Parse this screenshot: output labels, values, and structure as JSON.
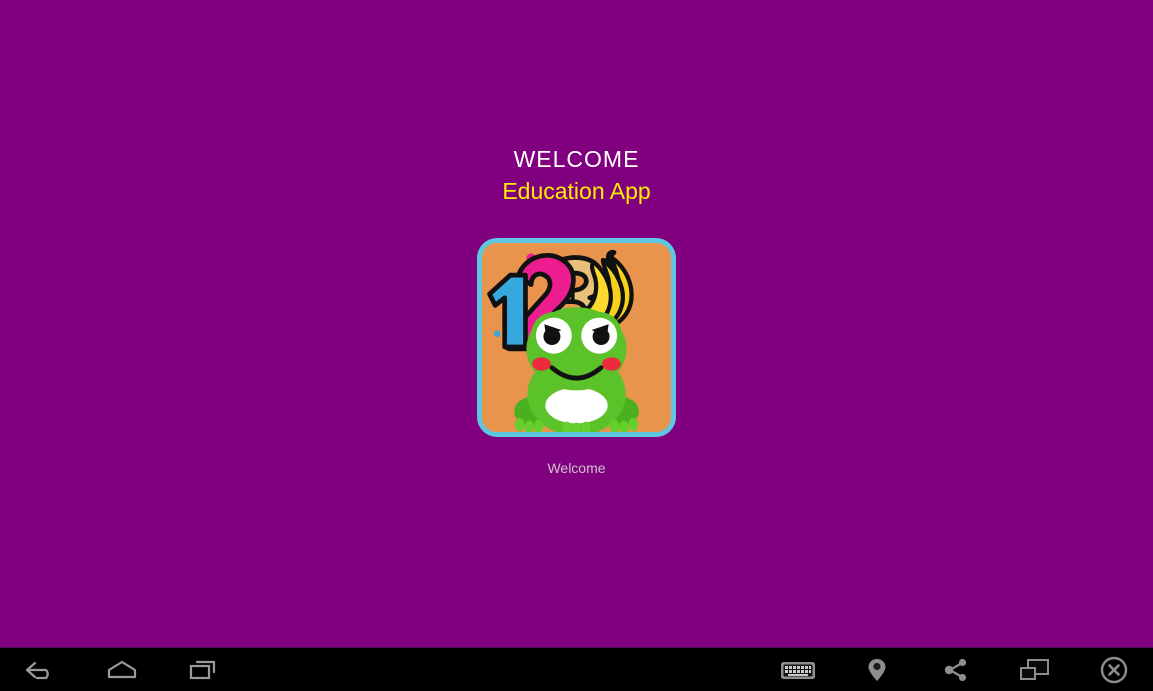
{
  "screen": {
    "background_color": "#800080",
    "edge_strip_color": "#2b2bd8"
  },
  "app": {
    "title": "WELCOME",
    "subtitle": "Education App",
    "title_color": "#ffffff",
    "subtitle_color": "#ffee00",
    "icon_label": "Welcome",
    "icon_label_color": "#cfc2cf",
    "icon": {
      "name": "education-app-icon",
      "background_color": "#e8944c",
      "border_color": "#5ec8e0",
      "elements": [
        "digit-1-blue",
        "digit-2-magenta",
        "digit-3-tan",
        "bananas",
        "frog"
      ],
      "digit_1_color": "#35a8dd",
      "digit_2_color": "#ee1d8f",
      "digit_3_color": "#e8c07a",
      "banana_color": "#f6d21c",
      "frog_color": "#5cc22a"
    }
  },
  "navbar": {
    "background_color": "#000000",
    "icon_color": "#9a9a9a",
    "left_buttons": [
      {
        "name": "back-icon",
        "label": "Back"
      },
      {
        "name": "home-icon",
        "label": "Home"
      },
      {
        "name": "recent-apps-icon",
        "label": "Recent apps"
      }
    ],
    "right_buttons": [
      {
        "name": "keyboard-icon",
        "label": "Keyboard"
      },
      {
        "name": "location-pin-icon",
        "label": "Location"
      },
      {
        "name": "share-icon",
        "label": "Share"
      },
      {
        "name": "resize-window-icon",
        "label": "Resize window"
      },
      {
        "name": "close-icon",
        "label": "Close"
      }
    ]
  }
}
